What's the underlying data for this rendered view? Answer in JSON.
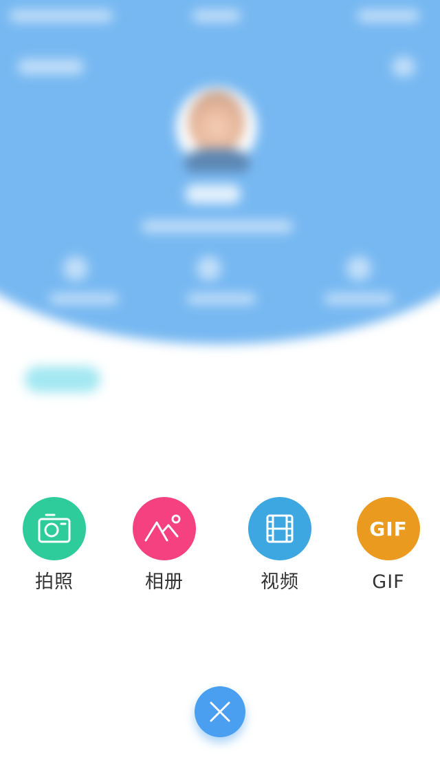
{
  "options": [
    {
      "label": "拍照",
      "icon": "camera-icon",
      "color": "#2ecc9a"
    },
    {
      "label": "相册",
      "icon": "image-icon",
      "color": "#f5417f"
    },
    {
      "label": "视频",
      "icon": "film-icon",
      "color": "#3ca7e0"
    },
    {
      "label": "GIF",
      "icon": "gif-icon",
      "icon_text": "GIF",
      "color": "#ea9a1e"
    }
  ],
  "close_button": {
    "icon": "close-icon",
    "color": "#4a9ff0"
  },
  "background": {
    "header_color": "#5aa9ef",
    "blurred": true
  }
}
